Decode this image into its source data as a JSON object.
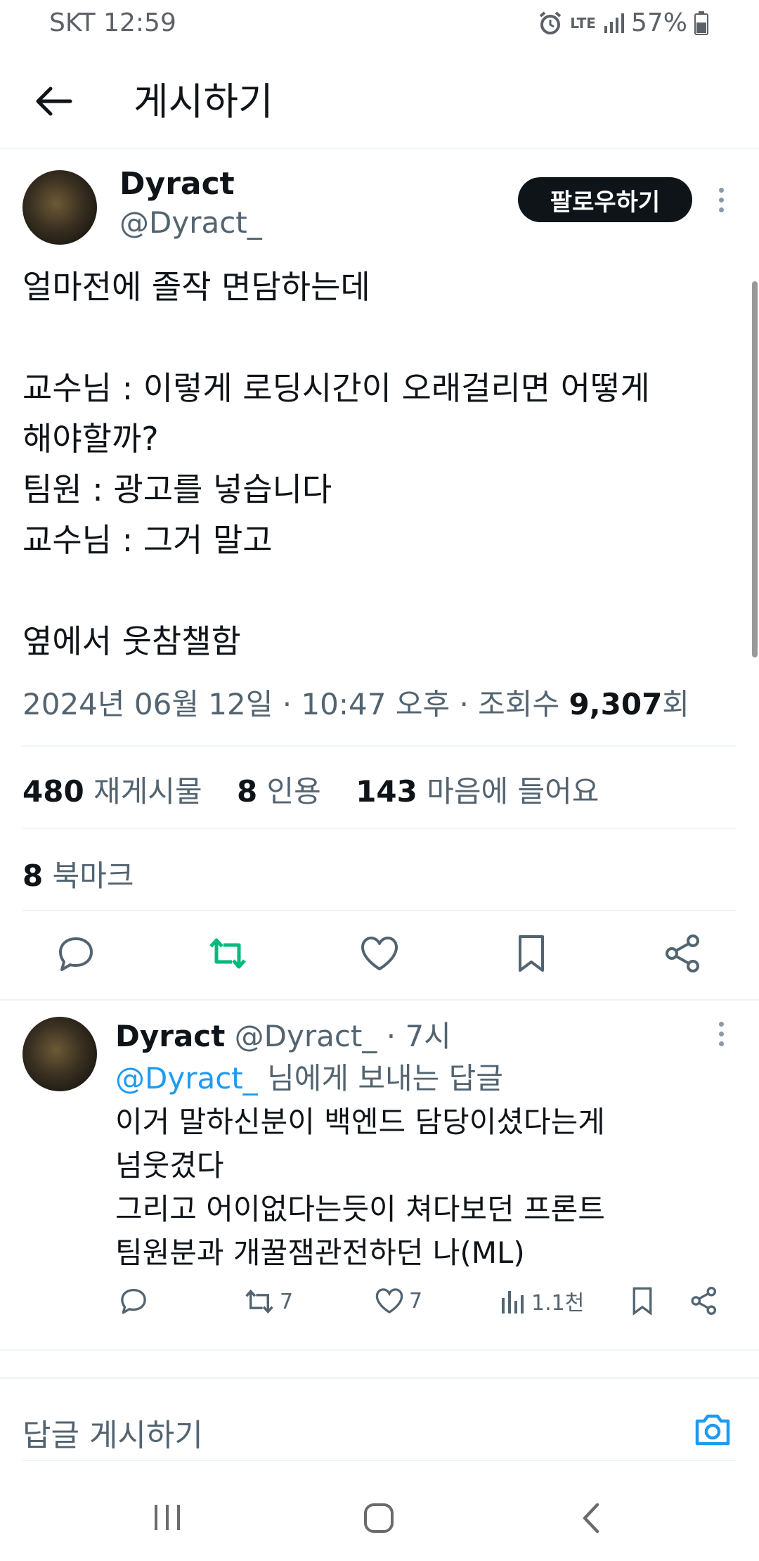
{
  "status_bar": {
    "carrier": "SKT",
    "time": "12:59",
    "network": "LTE",
    "battery": "57%"
  },
  "header": {
    "title": "게시하기"
  },
  "tweet": {
    "display_name": "Dyract",
    "handle": "@Dyract_",
    "follow_label": "팔로우하기",
    "body_lines": [
      "얼마전에 졸작 면담하는데",
      "",
      "교수님 : 이렇게 로딩시간이 오래걸리면 어떻게",
      "해야할까?",
      "팀원 : 광고를 넣습니다",
      "교수님 : 그거 말고",
      "",
      "옆에서 웃참챌함"
    ],
    "timestamp": "2024년 06월 12일 · 10:47 오후 · 조회수 ",
    "views": "9,307",
    "views_suffix": "회",
    "stats": {
      "reposts_count": "480",
      "reposts_label": "재게시물",
      "quotes_count": "8",
      "quotes_label": "인용",
      "likes_count": "143",
      "likes_label": "마음에 들어요",
      "bookmarks_count": "8",
      "bookmarks_label": "북마크"
    },
    "accent_color": "#00ba7c"
  },
  "reply": {
    "display_name": "Dyract",
    "handle": "@Dyract_",
    "age": " · 7시",
    "reply_to_handle": "@Dyract_",
    "reply_to_suffix": " 님에게 보내는 답글",
    "body_lines": [
      "이거 말하신분이 백엔드 담당이셨다는게",
      "넘웃겼다",
      "그리고 어이없다는듯이 쳐다보던 프론트",
      "팀원분과 개꿀잼관전하던 나(ML)"
    ],
    "reposts": "7",
    "likes": "7",
    "views": "1.1천"
  },
  "compose": {
    "placeholder": "답글 게시하기"
  },
  "colors": {
    "text": "#0f1419",
    "secondary": "#536471",
    "link": "#1d9bf0",
    "repost_active": "#00ba7c"
  }
}
